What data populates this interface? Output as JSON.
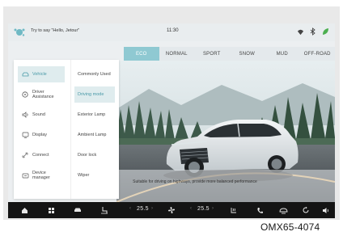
{
  "status_bar": {
    "voice_prompt": "Try to say \"Hello, Jetour\"",
    "time": "11:30",
    "icons": [
      "voice-assistant-icon",
      "wifi-icon",
      "bluetooth-icon",
      "eco-leaf-icon"
    ]
  },
  "drive_modes": {
    "tabs": [
      "ECO",
      "NORMAL",
      "SPORT",
      "SNOW",
      "MUD",
      "OFF-ROAD"
    ],
    "selected": "ECO",
    "description": "Suitable for driving on highways, provide more balanced performance"
  },
  "settings_panel": {
    "nav": [
      {
        "label": "Vehicle",
        "icon": "car-icon",
        "active": true
      },
      {
        "label": "Driver Assistance",
        "icon": "steering-assist-icon",
        "active": false
      },
      {
        "label": "Sound",
        "icon": "speaker-icon",
        "active": false
      },
      {
        "label": "Display",
        "icon": "display-icon",
        "active": false
      },
      {
        "label": "Connect",
        "icon": "link-icon",
        "active": false
      },
      {
        "label": "Device manager",
        "icon": "device-icon",
        "active": false
      }
    ],
    "sub": [
      {
        "label": "Commonly Used",
        "active": false
      },
      {
        "label": "Driving mode",
        "active": true
      },
      {
        "label": "Exterior Lamp",
        "active": false
      },
      {
        "label": "Ambient Lamp",
        "active": false
      },
      {
        "label": "Door lock",
        "active": false
      },
      {
        "label": "Wiper",
        "active": false
      }
    ]
  },
  "dock": {
    "left_temp": "25.5",
    "right_temp": "25.5",
    "left_chev_prev": "‹",
    "left_chev_next": "›",
    "right_chev_prev": "‹",
    "right_chev_next": "›",
    "icons": [
      "home-icon",
      "apps-icon",
      "car-icon",
      "seat-heat-icon",
      "fan-icon",
      "rear-defrost-icon",
      "phone-icon",
      "ac-icon",
      "recirculation-icon",
      "volume-icon"
    ]
  },
  "reference_code": "OMX65-4074",
  "colors": {
    "accent": "#8fc9d2",
    "active_bg": "#dfecee",
    "dock": "#141414"
  }
}
